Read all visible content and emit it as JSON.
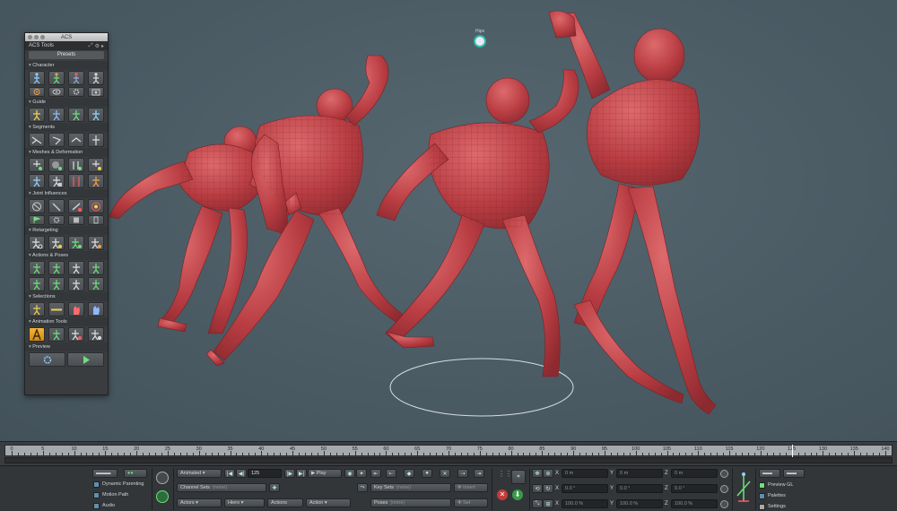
{
  "viewport": {
    "hips_label": "Hips"
  },
  "acs_panel": {
    "window_title": "ACS",
    "tab_label": "ACS Tools",
    "presets_label": "Presets",
    "sections": [
      "Character",
      "Guide",
      "Segments",
      "Meshes & Deformation",
      "Joint Influences",
      "Retargeting",
      "Actions & Poses",
      "Selections",
      "Animation Tools",
      "Preview"
    ]
  },
  "timeline": {
    "ticks": [
      "0",
      "5",
      "10",
      "15",
      "20",
      "25",
      "30",
      "35",
      "40",
      "45",
      "50",
      "55",
      "60",
      "65",
      "70",
      "75",
      "80",
      "85",
      "90",
      "95",
      "100",
      "105",
      "110",
      "115",
      "120",
      "125",
      "130",
      "135",
      "140"
    ],
    "current_frame": "125"
  },
  "toolbar": {
    "dynamic_parenting": "Dynamic Parenting",
    "motion_path": "Motion Path",
    "audio": "Audio",
    "mode": "Animated",
    "frame": "125",
    "play": "Play",
    "channel_sets": "Channel Sets",
    "channel_sets_value": "(none)",
    "key_sets": "Key Sets",
    "key_sets_value": "(none)",
    "insert": "Insert",
    "actors": "Actors",
    "hierarchy": "Hiero",
    "actions": "Actions",
    "action": "Action",
    "poses": "Poses",
    "poses_value": "(none)",
    "set": "Set",
    "pos_x": "0 m",
    "pos_y": "0 m",
    "pos_z": "0 m",
    "rot_x": "0.0 °",
    "rot_y": "0.0 °",
    "rot_z": "0.0 °",
    "scl_x": "100.0 %",
    "scl_y": "100.0 %",
    "scl_z": "100.0 %",
    "axis_x": "X",
    "axis_y": "Y",
    "axis_z": "Z",
    "preview_gl": "Preview GL",
    "palettes": "Palettes",
    "settings": "Settings"
  },
  "colors": {
    "accent_teal": "#2fb8b0",
    "active_orange": "#e09a22",
    "figure_red": "#c2464a"
  }
}
